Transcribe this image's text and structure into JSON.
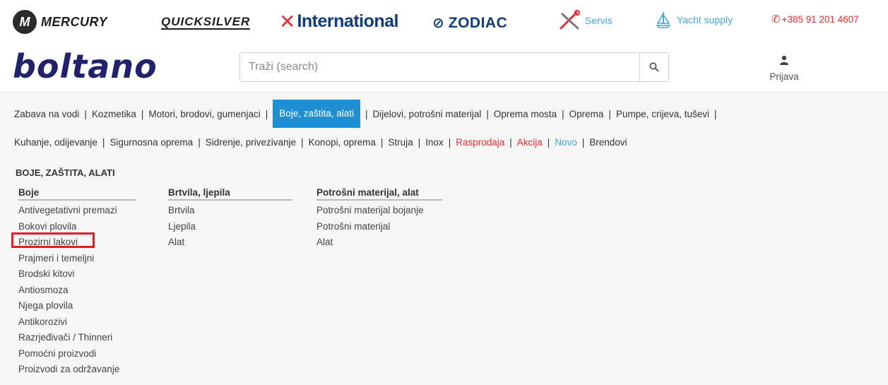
{
  "brands": {
    "mercury": "MERCURY",
    "quicksilver": "QUICKSILVER",
    "international": "International",
    "zodiac": "ZODIAC",
    "servis": "Servis",
    "yacht_supply": "Yacht supply",
    "phone": "+385 91 201 4607"
  },
  "header": {
    "logo": "boltano",
    "search_placeholder": "Traži (search)",
    "login_label": "Prijava"
  },
  "nav": {
    "row1": [
      "Zabava na vodi",
      "Kozmetika",
      "Motori, brodovi, gumenjaci",
      "Boje, zaštita, alati",
      "Dijelovi, potrošni materijal",
      "Oprema mosta",
      "Oprema",
      "Pumpe, crijeva, tuševi"
    ],
    "row2": [
      "Kuhanje, odijevanje",
      "Sigurnosna oprema",
      "Sidrenje, privezivanje",
      "Konopi, oprema",
      "Struja",
      "Inox",
      "Rasprodaja",
      "Akcija",
      "Novo",
      "Brendovi"
    ],
    "active": "Boje, zaštita, alati"
  },
  "submenu": {
    "title": "BOJE, ZAŠTITA, ALATI",
    "columns": [
      {
        "heading": "Boje",
        "items": [
          "Antivegetativni premazi",
          "Bokovi plovila",
          "Prozirni lakovi",
          "Prajmeri i temeljni",
          "Brodski kitovi",
          "Antiosmoza",
          "Njega plovila",
          "Antikorozivi",
          "Razrjeđivači / Thinneri",
          "Pomoćni proizvodi",
          "Proizvodi za održavanje"
        ]
      },
      {
        "heading": "Brtvila, ljepila",
        "items": [
          "Brtvila",
          "Ljepila",
          "Alat"
        ]
      },
      {
        "heading": "Potrošni materijal, alat",
        "items": [
          "Potrošni materijal bojanje",
          "Potrošni materijal",
          "Alat"
        ]
      }
    ]
  },
  "colors": {
    "accent": "#1e8fd0",
    "sale_red": "#e52b2b",
    "new_blue": "#3fa6d9",
    "logo_navy": "#22216b",
    "highlight_red": "#e01e25"
  },
  "icons": [
    "mercury-logo-icon",
    "zodiac-slash-icon",
    "servis-tools-icon",
    "yacht-supply-icon",
    "phone-icon",
    "search-icon",
    "user-icon"
  ]
}
